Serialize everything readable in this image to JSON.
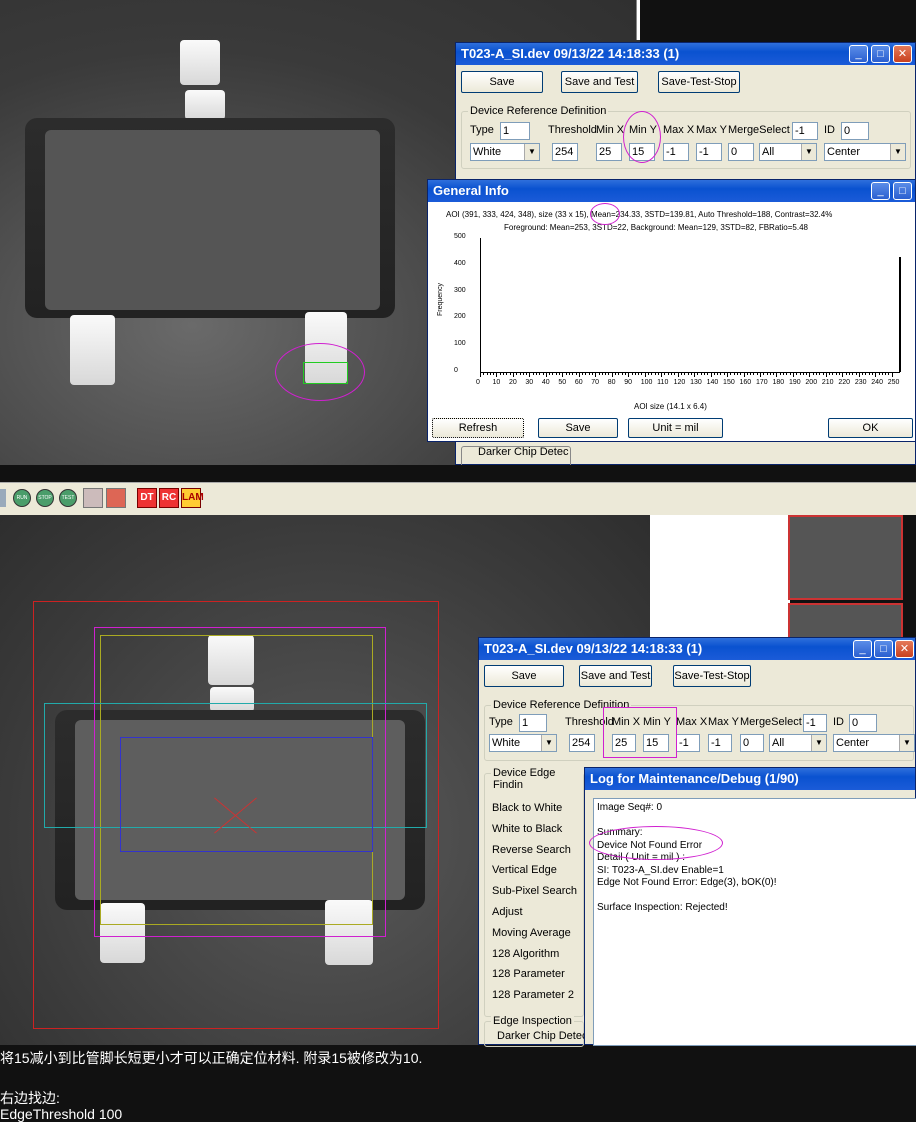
{
  "win1": {
    "title": "T023-A_SI.dev 09/13/22 14:18:33 (1)",
    "buttons": {
      "save": "Save",
      "save_test": "Save and Test",
      "save_test_stop": "Save-Test-Stop"
    },
    "group_device_ref": "Device Reference Definition",
    "type_label": "Type",
    "type_value": "1",
    "threshold_label": "Threshold",
    "minx_label": "Min X",
    "miny_label": "Min Y",
    "maxx_label": "Max X",
    "maxy_label": "Max Y",
    "merge_label": "MergeSelect",
    "merge_value": "-1",
    "id_label": "ID",
    "id_value": "0",
    "color_value": "White",
    "threshold_value": "254",
    "minx_value": "25",
    "miny_value": "15",
    "maxx_value": "-1",
    "maxy_value": "-1",
    "merge_sel_value": "0",
    "all_value": "All",
    "center_value": "Center",
    "group_darker": "Darker Chip Detec"
  },
  "general": {
    "title": "General Info",
    "line1": "AOI (391, 333, 424, 348), size (33 x 15), Mean=234.33, 3STD=139.81, Auto Threshold=188, Contrast=32.4%",
    "line2": "Foreground: Mean=253, 3STD=22, Background: Mean=129, 3STD=82, FBRatio=5.48",
    "ylabel": "Frequency",
    "yticks": [
      "500",
      "400",
      "300",
      "200",
      "100",
      "0"
    ],
    "xticks": [
      "0",
      "10",
      "20",
      "30",
      "40",
      "50",
      "60",
      "70",
      "80",
      "90",
      "100",
      "110",
      "120",
      "130",
      "140",
      "150",
      "160",
      "170",
      "180",
      "190",
      "200",
      "210",
      "220",
      "230",
      "240",
      "250"
    ],
    "xlabel": "AOI size (14.1 x 6.4)",
    "buttons": {
      "refresh": "Refresh",
      "save": "Save",
      "unit": "Unit = mil",
      "ok": "OK"
    }
  },
  "chart_data": {
    "type": "bar",
    "title": "",
    "xlabel": "AOI size (14.1 x 6.4)",
    "ylabel": "Frequency",
    "xlim": [
      0,
      255
    ],
    "ylim": [
      0,
      500
    ],
    "x": [
      0,
      255
    ],
    "values": [
      0,
      430
    ]
  },
  "toolbar": {
    "run": "RUN",
    "stop": "STOP",
    "test": "TEST",
    "dt": "DT",
    "rc": "RC",
    "lam": "LAM"
  },
  "win2": {
    "title": "T023-A_SI.dev 09/13/22 14:18:33 (1)",
    "buttons": {
      "save": "Save",
      "save_test": "Save and Test",
      "save_test_stop": "Save-Test-Stop"
    },
    "group_device_ref": "Device Reference Definition",
    "type_label": "Type",
    "type_value": "1",
    "threshold_label": "Threshold",
    "minx_label": "Min X",
    "miny_label": "Min Y",
    "maxx_label": "Max X",
    "maxy_label": "Max Y",
    "merge_label": "MergeSelect",
    "merge_value": "-1",
    "id_label": "ID",
    "id_value": "0",
    "color_value": "White",
    "threshold_value": "254",
    "minx_value": "25",
    "miny_value": "15",
    "maxx_value": "-1",
    "maxy_value": "-1",
    "merge_sel_value": "0",
    "all_value": "All",
    "center_value": "Center",
    "group_edge": "Device Edge Findin",
    "options": [
      "Black to White",
      "White to Black",
      "Reverse Search",
      "Vertical Edge",
      "Sub-Pixel Search",
      "Adjust",
      "Moving Average",
      "128 Algorithm",
      "128 Parameter",
      "128 Parameter 2"
    ],
    "group_edge_insp": "Edge Inspection",
    "group_darker": "Darker Chip Detec"
  },
  "log": {
    "title": "Log for Maintenance/Debug (1/90)",
    "lines": [
      "Image Seq#: 0",
      "",
      "Summary:",
      "Device Not Found Error",
      "Detail ( Unit = mil ) :",
      "SI: T023-A_SI.dev Enable=1",
      "Edge Not Found Error: Edge(3), bOK(0)!",
      "",
      "Surface Inspection: Rejected!"
    ]
  },
  "notes": {
    "line1": "将15减小到比管脚长短更小才可以正确定位材料. 附录15被修改为10.",
    "line2": "右边找边:",
    "line3": "EdgeThreshold 100"
  }
}
